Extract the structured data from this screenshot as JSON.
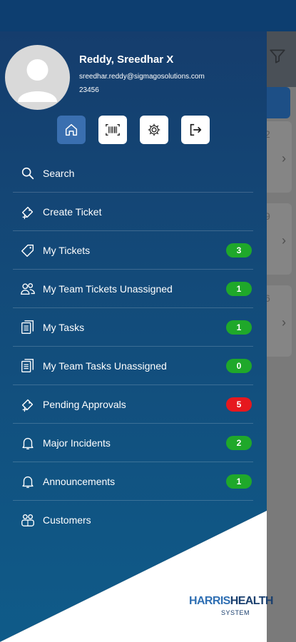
{
  "colors": {
    "drawer_top": "#153d6d",
    "drawer_bottom": "#0f5b89",
    "badge_green": "#1fa82a",
    "badge_red": "#e6181e",
    "active_button": "#3a6fb0",
    "logo_dark": "#1a3f6e",
    "logo_light": "#2f6fb3"
  },
  "background": {
    "card_numbers": [
      "2",
      "9",
      "6"
    ]
  },
  "profile": {
    "name": "Reddy, Sreedhar X",
    "email": "sreedhar.reddy@sigmagosolutions.com",
    "id": "23456",
    "avatar_icon": "user-avatar-icon"
  },
  "quick_actions": [
    {
      "name": "home",
      "icon": "home-icon",
      "active": true
    },
    {
      "name": "scan",
      "icon": "barcode-icon",
      "active": false
    },
    {
      "name": "settings",
      "icon": "gear-icon",
      "active": false
    },
    {
      "name": "logout",
      "icon": "logout-icon",
      "active": false
    }
  ],
  "menu": [
    {
      "label": "Search",
      "icon": "search-icon",
      "badge": null
    },
    {
      "label": "Create Ticket",
      "icon": "ticket-add-icon",
      "badge": null
    },
    {
      "label": "My Tickets",
      "icon": "ticket-icon",
      "badge": "3",
      "badge_color": "green"
    },
    {
      "label": "My Team Tickets Unassigned",
      "icon": "team-icon",
      "badge": "1",
      "badge_color": "green"
    },
    {
      "label": "My Tasks",
      "icon": "tasks-icon",
      "badge": "1",
      "badge_color": "green"
    },
    {
      "label": "My Team Tasks Unassigned",
      "icon": "tasks-icon",
      "badge": "0",
      "badge_color": "green"
    },
    {
      "label": "Pending Approvals",
      "icon": "ticket-add-icon",
      "badge": "5",
      "badge_color": "red"
    },
    {
      "label": "Major Incidents",
      "icon": "bell-icon",
      "badge": "2",
      "badge_color": "green"
    },
    {
      "label": "Announcements",
      "icon": "bell-icon",
      "badge": "1",
      "badge_color": "green"
    },
    {
      "label": "Customers",
      "icon": "customers-icon",
      "badge": null
    }
  ],
  "logo": {
    "part1": "HARRIS",
    "part2": "HEALTH",
    "subtitle": "SYSTEM"
  }
}
